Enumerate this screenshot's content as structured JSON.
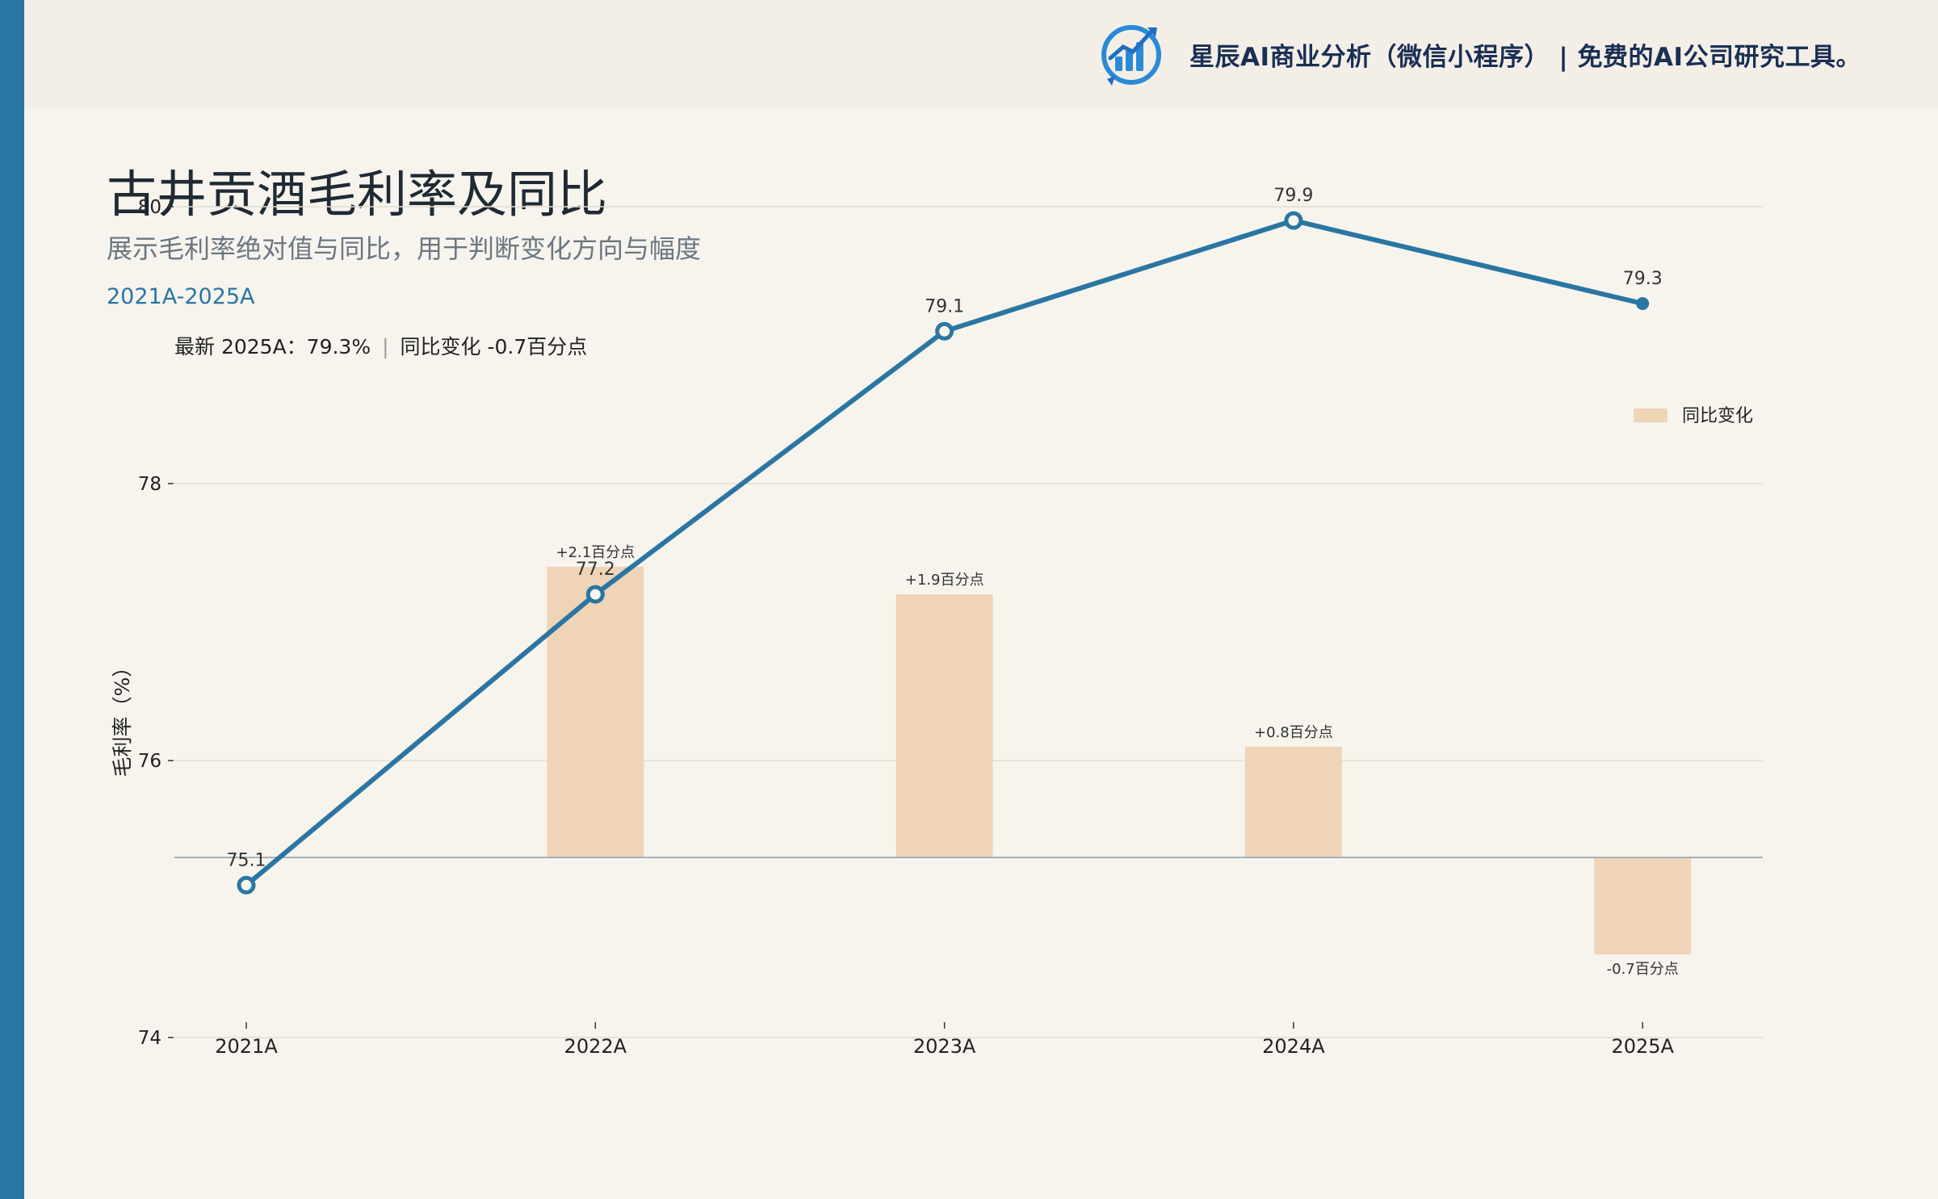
{
  "brand": {
    "text": "星辰AI商业分析（微信小程序）  |  免费的AI公司研究工具。",
    "logo_icon": "bar-chart-growth-logo",
    "color": "#1a2f55"
  },
  "header": {
    "title": "古井贡酒毛利率及同比",
    "subtitle": "展示毛利率绝对值与同比，用于判断变化方向与幅度",
    "range": "2021A-2025A"
  },
  "summary": {
    "latest": "最新 2025A：79.3%",
    "separator": "|",
    "change": "同比变化 -0.7百分点"
  },
  "colors": {
    "accent": "#2a76a3",
    "bar": "#efd4b8",
    "background": "#f7f4ee"
  },
  "chart_data": {
    "type": "bar+line",
    "categories": [
      "2021A",
      "2022A",
      "2023A",
      "2024A",
      "2025A"
    ],
    "ylabel": "毛利率（%）",
    "ylim": [
      73,
      82
    ],
    "yticks": [
      74,
      76,
      78,
      80,
      82
    ],
    "grid": true,
    "legend_position": "top-right",
    "series": [
      {
        "kind": "line",
        "values": [
          75.1,
          77.2,
          79.1,
          79.9,
          79.3
        ],
        "labels": [
          "75.1",
          "77.2",
          "79.1",
          "79.9",
          "79.3"
        ]
      },
      {
        "kind": "bar",
        "name": "同比变化",
        "values": [
          null,
          2.1,
          1.9,
          0.8,
          -0.7
        ],
        "labels": [
          "",
          "+2.1百分点",
          "+1.9百分点",
          "+0.8百分点",
          "-0.7百分点"
        ]
      }
    ]
  }
}
